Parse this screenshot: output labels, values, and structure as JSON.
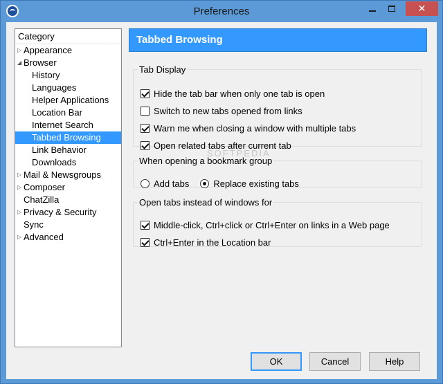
{
  "window": {
    "title": "Preferences"
  },
  "sidebar": {
    "header": "Category",
    "items": [
      {
        "label": "Appearance",
        "twisty": "▷"
      },
      {
        "label": "Browser",
        "twisty": "◢"
      },
      {
        "label": "History"
      },
      {
        "label": "Languages"
      },
      {
        "label": "Helper Applications"
      },
      {
        "label": "Location Bar"
      },
      {
        "label": "Internet Search"
      },
      {
        "label": "Tabbed Browsing",
        "selected": true
      },
      {
        "label": "Link Behavior"
      },
      {
        "label": "Downloads"
      },
      {
        "label": "Mail & Newsgroups",
        "twisty": "▷"
      },
      {
        "label": "Composer",
        "twisty": "▷"
      },
      {
        "label": "ChatZilla"
      },
      {
        "label": "Privacy & Security",
        "twisty": "▷"
      },
      {
        "label": "Sync"
      },
      {
        "label": "Advanced",
        "twisty": "▷"
      }
    ]
  },
  "panel": {
    "title": "Tabbed Browsing",
    "tab_display": {
      "legend": "Tab Display",
      "options": [
        {
          "label": "Hide the tab bar when only one tab is open",
          "checked": true
        },
        {
          "label": "Switch to new tabs opened from links",
          "checked": false
        },
        {
          "label": "Warn me when closing a window with multiple tabs",
          "checked": true
        },
        {
          "label": "Open related tabs after current tab",
          "checked": true
        }
      ]
    },
    "bookmark_group": {
      "legend": "When opening a bookmark group",
      "add_tabs": "Add tabs",
      "replace_tabs": "Replace existing tabs",
      "selected": "replace"
    },
    "open_tabs": {
      "legend": "Open tabs instead of windows for",
      "options": [
        {
          "label": "Middle-click, Ctrl+click or Ctrl+Enter on links in a Web page",
          "checked": true
        },
        {
          "label": "Ctrl+Enter in the Location bar",
          "checked": true
        }
      ]
    }
  },
  "buttons": {
    "ok": "OK",
    "cancel": "Cancel",
    "help": "Help"
  },
  "watermark": "SOFTPEDIA",
  "colors": {
    "titlebar": "#5b9ad6",
    "accent": "#3399ff",
    "close": "#c75050"
  }
}
